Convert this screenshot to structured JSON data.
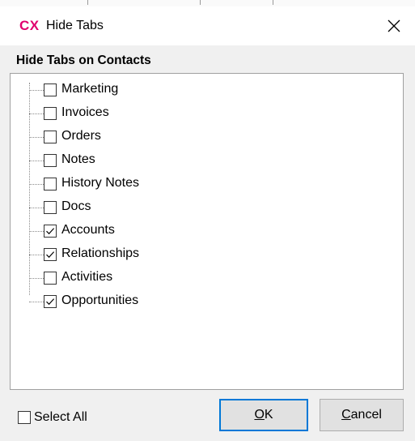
{
  "window": {
    "app_logo": "CX",
    "title": "Hide Tabs",
    "close_icon": "close-icon"
  },
  "group": {
    "heading": "Hide Tabs on Contacts"
  },
  "tabs": [
    {
      "label": "Marketing",
      "checked": false
    },
    {
      "label": "Invoices",
      "checked": false
    },
    {
      "label": "Orders",
      "checked": false
    },
    {
      "label": "Notes",
      "checked": false
    },
    {
      "label": "History Notes",
      "checked": false
    },
    {
      "label": "Docs",
      "checked": false
    },
    {
      "label": "Accounts",
      "checked": true
    },
    {
      "label": "Relationships",
      "checked": true
    },
    {
      "label": "Activities",
      "checked": false
    },
    {
      "label": "Opportunities",
      "checked": true
    }
  ],
  "footer": {
    "select_all_label": "Select All",
    "select_all_checked": false,
    "ok_label": "OK",
    "cancel_label": "Cancel"
  },
  "colors": {
    "logo": "#e0006e",
    "default_button_border": "#0078d7",
    "client_background": "#f0f0f0"
  }
}
